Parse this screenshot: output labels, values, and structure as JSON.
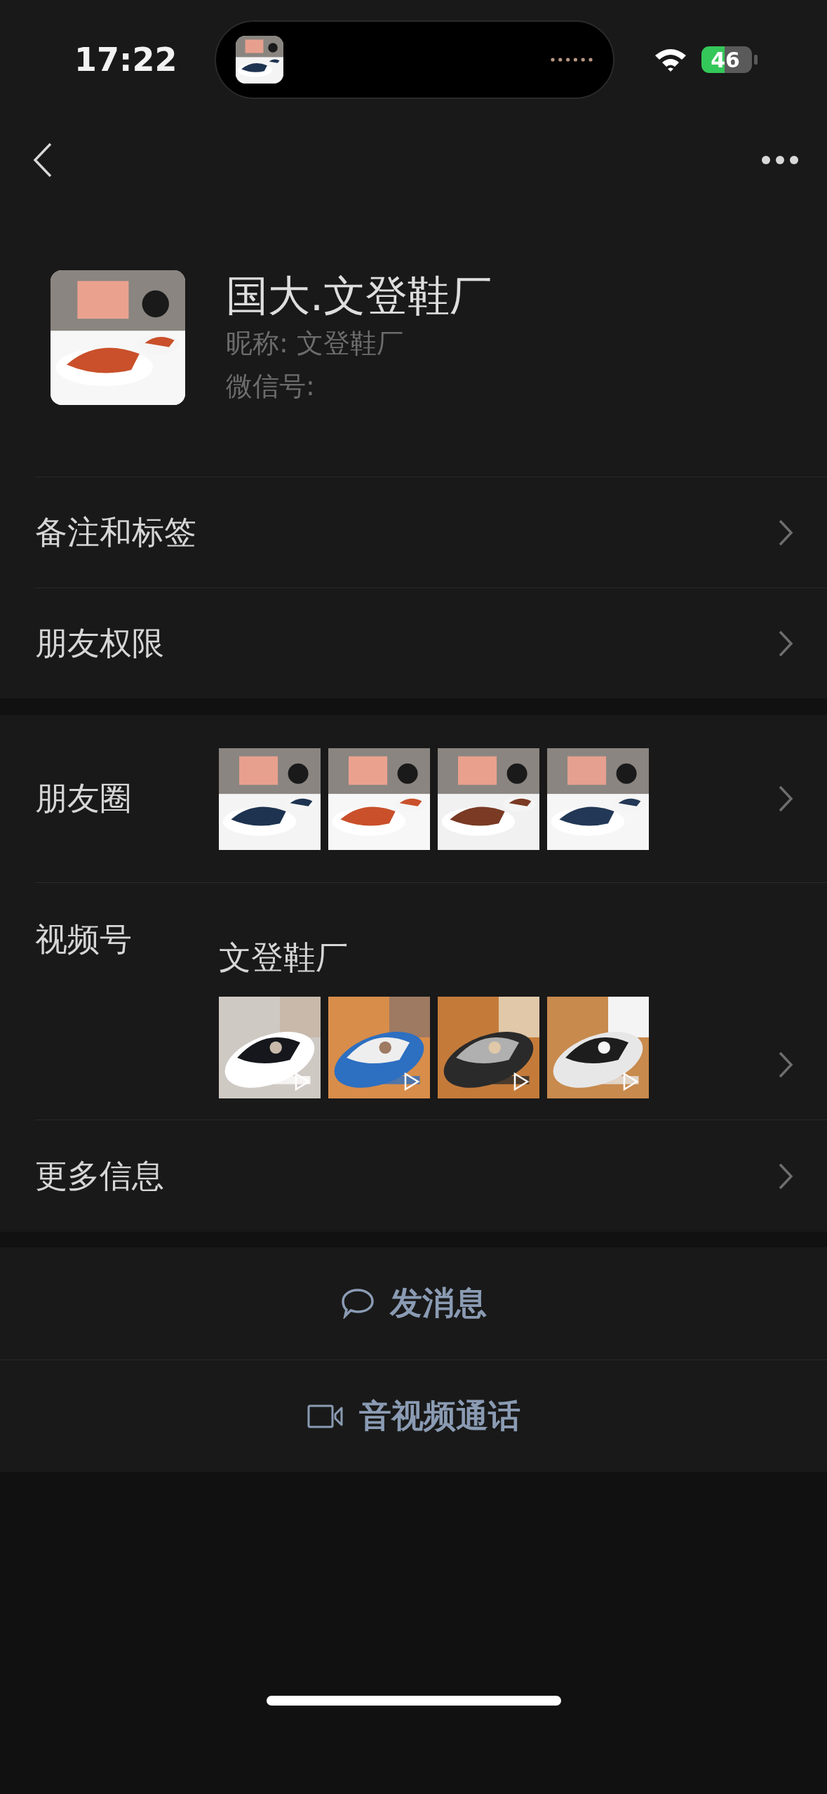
{
  "status_bar": {
    "time": "17:22",
    "battery": "46"
  },
  "profile": {
    "name": "国大.文登鞋厂",
    "nickname": "昵称: 文登鞋厂",
    "wechat_id_label": "微信号:"
  },
  "menu": [
    {
      "label": "备注和标签"
    },
    {
      "label": "朋友权限"
    }
  ],
  "moments": {
    "label": "朋友圈"
  },
  "channels": {
    "label": "视频号",
    "name": "文登鞋厂",
    "videos": [
      {
        "kind": "video"
      },
      {
        "kind": "video"
      },
      {
        "kind": "video"
      },
      {
        "kind": "video"
      }
    ]
  },
  "more": {
    "label": "更多信息"
  },
  "actions": [
    {
      "label": "发消息",
      "kind": "message"
    },
    {
      "label": "音视频通话",
      "kind": "call"
    }
  ]
}
